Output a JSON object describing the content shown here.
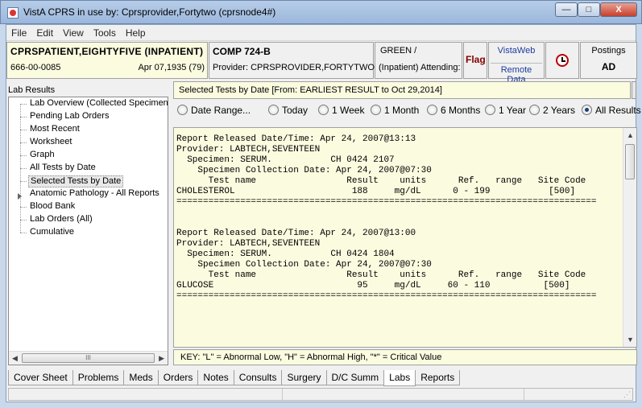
{
  "window": {
    "title": "VistA CPRS in use by: Cprsprovider,Fortytwo  (cprsnode4#)",
    "minimize": "—",
    "maximize": "□",
    "close": "X"
  },
  "menu": [
    "File",
    "Edit",
    "View",
    "Tools",
    "Help"
  ],
  "patient": {
    "name": "CPRSPATIENT,EIGHTYFIVE (INPATIENT)",
    "ssn": "666-00-0085",
    "dob": "Apr 07,1935 (79)"
  },
  "location": {
    "name": "COMP 724-B",
    "provider": "Provider:  CPRSPROVIDER,FORTYTWO"
  },
  "team": {
    "line1": "GREEN /",
    "line2": "(Inpatient) Attending:"
  },
  "flag": {
    "label": "Flag"
  },
  "vistaweb": {
    "label1": "VistaWeb",
    "label2": "Remote Data"
  },
  "postings": {
    "label": "Postings",
    "value": "AD"
  },
  "tree": {
    "title": "Lab Results",
    "items": [
      "Lab Overview (Collected Specimens)",
      "Pending Lab Orders",
      "Most Recent",
      "Worksheet",
      "Graph",
      "All Tests by Date",
      "Selected Tests by Date",
      "Anatomic Pathology - All Reports",
      "Blood Bank",
      "Lab Orders (All)",
      "Cumulative"
    ],
    "selected": "Selected Tests by Date",
    "scroll_label": "III"
  },
  "report": {
    "title": "Selected Tests by Date [From: EARLIEST RESULT to Oct 29,2014]",
    "ranges": [
      "Date Range...",
      "Today",
      "1 Week",
      "1 Month",
      "6 Months",
      "1 Year",
      "2 Years",
      "All Results"
    ],
    "selected_range": "All Results",
    "text": "Report Released Date/Time: Apr 24, 2007@13:13\nProvider: LABTECH,SEVENTEEN\n  Specimen: SERUM.           CH 0424 2107\n    Specimen Collection Date: Apr 24, 2007@07:30\n      Test name                 Result    units      Ref.   range   Site Code\nCHOLESTEROL                      188     mg/dL      0 - 199           [500]\n===============================================================================\n\n\nReport Released Date/Time: Apr 24, 2007@13:00\nProvider: LABTECH,SEVENTEEN\n  Specimen: SERUM.           CH 0424 1804\n    Specimen Collection Date: Apr 24, 2007@07:30\n      Test name                 Result    units      Ref.   range   Site Code\nGLUCOSE                           95     mg/dL     60 - 110          [500]\n===============================================================================",
    "key": "KEY: \"L\" = Abnormal Low, \"H\" = Abnormal High, \"*\" = Critical Value"
  },
  "tabs": [
    "Cover Sheet",
    "Problems",
    "Meds",
    "Orders",
    "Notes",
    "Consults",
    "Surgery",
    "D/C Summ",
    "Labs",
    "Reports"
  ],
  "active_tab": "Labs"
}
